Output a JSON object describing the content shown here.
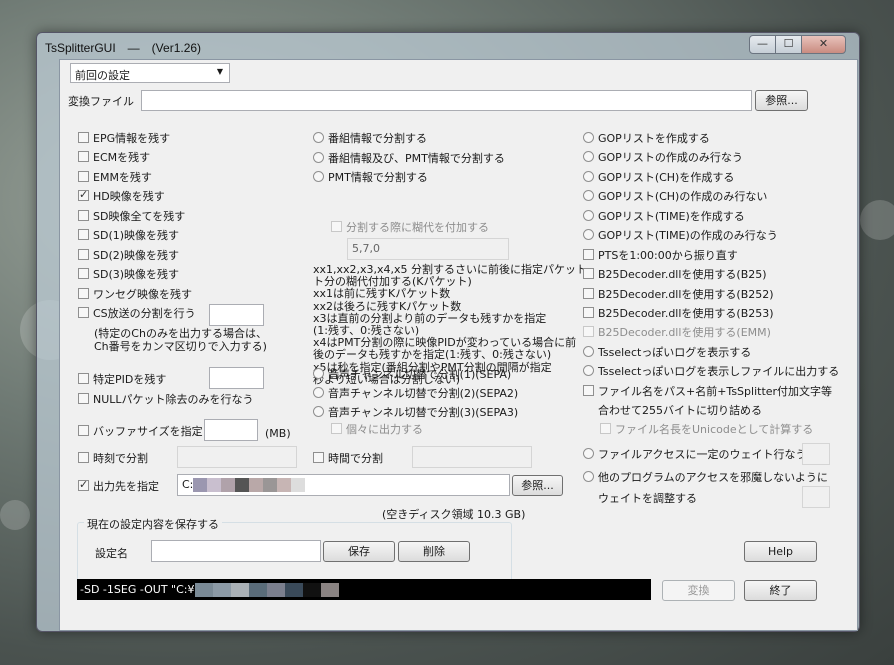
{
  "window": {
    "title": "TsSplitterGUI　—　(Ver1.26)"
  },
  "preset": {
    "selected": "前回の設定"
  },
  "input_file": {
    "label": "変換ファイル",
    "value": "",
    "browse": "参照..."
  },
  "left_options": [
    {
      "label": "EPG情報を残す",
      "checked": false
    },
    {
      "label": "ECMを残す",
      "checked": false
    },
    {
      "label": "EMMを残す",
      "checked": false
    },
    {
      "label": "HD映像を残す",
      "checked": true
    },
    {
      "label": "SD映像全てを残す",
      "checked": false
    },
    {
      "label": "SD(1)映像を残す",
      "checked": false
    },
    {
      "label": "SD(2)映像を残す",
      "checked": false
    },
    {
      "label": "SD(3)映像を残す",
      "checked": false
    },
    {
      "label": "ワンセグ映像を残す",
      "checked": false
    },
    {
      "label": "CS放送の分割を行う",
      "checked": false
    }
  ],
  "cs_note": [
    "(特定のChのみを出力する場合は、",
    "Ch番号をカンマ区切りで入力する)"
  ],
  "pid": {
    "label": "特定PIDを残す"
  },
  "null_packet": {
    "label": "NULLパケット除去のみを行なう"
  },
  "buffer": {
    "label": "バッファサイズを指定",
    "unit": "(MB)"
  },
  "time_split": {
    "label": "時刻で分割"
  },
  "duration_split": {
    "label": "時間で分割"
  },
  "output": {
    "label": "出力先を指定",
    "value": "C:",
    "browse": "参照...",
    "free_space": "(空きディスク領域 10.3 GB)"
  },
  "save_group": {
    "title": "現在の設定内容を保存する",
    "name_label": "設定名",
    "save": "保存",
    "delete": "削除"
  },
  "mid_options": [
    "番組情報で分割する",
    "番組情報及び、PMT情報で分割する",
    "PMT情報で分割する"
  ],
  "margin": {
    "label": "分割する際に糊代を付加する",
    "value": "5,7,0"
  },
  "margin_help": [
    "xx1,xx2,x3,x4,x5 分割するさいに前後に指定パケット",
    "ト分の糊代付加する(Kパケット)",
    "xx1は前に残すKパケット数",
    "xx2は後ろに残すKパケット数",
    "x3は直前の分割より前のデータも残すかを指定",
    "(1:残す、0:残さない)",
    "x4はPMT分割の際に映像PIDが変わっている場合に前",
    "後のデータも残すかを指定(1:残す、0:残さない)",
    "x5は秒を指定(番組分割やPMT分割の間隔が指定",
    "秒より短い場合は分割しない)"
  ],
  "audio_options": [
    "音声チャンネル切替で分割(1)(SEPA)",
    "音声チャンネル切替で分割(2)(SEPA2)",
    "音声チャンネル切替で分割(3)(SEPA3)"
  ],
  "separate_output": {
    "label": "個々に出力する"
  },
  "right_options": [
    "GOPリストを作成する",
    "GOPリストの作成のみ行なう",
    "GOPリスト(CH)を作成する",
    "GOPリスト(CH)の作成のみ行ない",
    "GOPリスト(TIME)を作成する",
    "GOPリスト(TIME)の作成のみ行なう",
    "PTSを1:00:00から振り直す",
    "B25Decoder.dllを使用する(B25)",
    "B25Decoder.dllを使用する(B252)",
    "B25Decoder.dllを使用する(B253)",
    "B25Decoder.dllを使用する(EMM)",
    "Tsselectっぽいログを表示する",
    "Tsselectっぽいログを表示しファイルに出力する"
  ],
  "filename_opt": {
    "label": "ファイル名をパス+名前+TsSplitter付加文字等",
    "label2": "合わせて255バイトに切り詰める",
    "unicode": "ファイル名長をUnicodeとして計算する"
  },
  "file_wait": {
    "label": "ファイルアクセスに一定のウェイト行なう"
  },
  "other_wait": {
    "label": "他のプログラムのアクセスを邪魔しないように",
    "label2": "ウェイトを調整する"
  },
  "help": "Help",
  "command": "-SD -1SEG -OUT \"C:¥",
  "convert": "変換",
  "exit": "終了"
}
